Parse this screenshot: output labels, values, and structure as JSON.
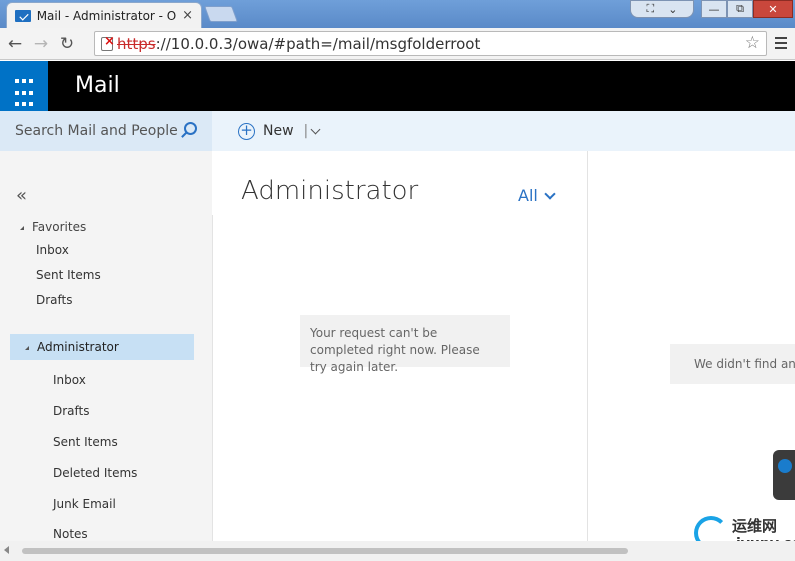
{
  "browser": {
    "tab_title": "Mail - Administrator - Out",
    "tab_close": "×",
    "url_scheme": "https",
    "url_rest": "://10.0.0.3/owa/#path=/mail/msgfolderroot",
    "nav": {
      "back": "←",
      "forward": "→",
      "reload": "↻"
    },
    "star": "☆",
    "window": {
      "fullscreen": "⛶",
      "dropdown": "⌄",
      "minimize": "—",
      "maximize": "⧉",
      "close": "✕"
    }
  },
  "owa": {
    "app_title": "Mail",
    "search_placeholder": "Search Mail and People",
    "new_label": "New",
    "new_separator": "|",
    "collapse": "«",
    "favorites": {
      "heading": "Favorites",
      "items": [
        "Inbox",
        "Sent Items",
        "Drafts"
      ]
    },
    "account": {
      "name": "Administrator",
      "folders": [
        "Inbox",
        "Drafts",
        "Sent Items",
        "Deleted Items",
        "Junk Email",
        "Notes"
      ]
    },
    "list_title": "Administrator",
    "filter_label": "All",
    "error_message": "Your request can't be completed right now. Please try again later.",
    "reading_message": "We didn't find any"
  },
  "watermark": {
    "cn": "运维网",
    "url": "iyunv.com"
  },
  "colors": {
    "accent": "#0072c6",
    "selected": "#c7e0f4",
    "header": "#000000"
  }
}
